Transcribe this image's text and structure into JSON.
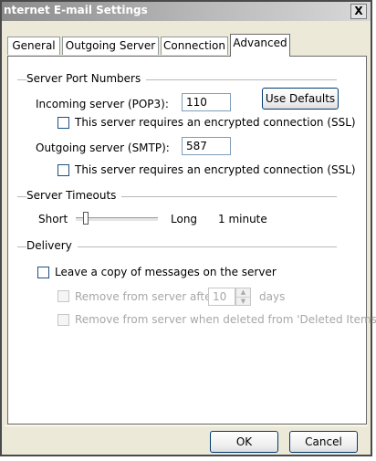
{
  "window": {
    "title": "nternet E-mail Settings",
    "close": "X"
  },
  "tabs": [
    {
      "label": "General"
    },
    {
      "label": "Outgoing Server"
    },
    {
      "label": "Connection"
    },
    {
      "label": "Advanced"
    }
  ],
  "server_ports": {
    "section_label": "Server Port Numbers",
    "incoming_label": "Incoming server (POP3):",
    "incoming_value": "110",
    "use_defaults": "Use Defaults",
    "incoming_ssl": "This server requires an encrypted connection (SSL)",
    "outgoing_label": "Outgoing server (SMTP):",
    "outgoing_value": "587",
    "outgoing_ssl": "This server requires an encrypted connection (SSL)"
  },
  "timeouts": {
    "section_label": "Server Timeouts",
    "short": "Short",
    "long": "Long",
    "value": "1 minute",
    "slider_level": 0.1
  },
  "delivery": {
    "section_label": "Delivery",
    "leave_copy": "Leave a copy of messages on the server",
    "remove_after": "Remove from server after",
    "days_value": "10",
    "days_label": "days",
    "remove_deleted": "Remove from server when deleted from 'Deleted Items'"
  },
  "footer": {
    "ok": "OK",
    "cancel": "Cancel"
  }
}
